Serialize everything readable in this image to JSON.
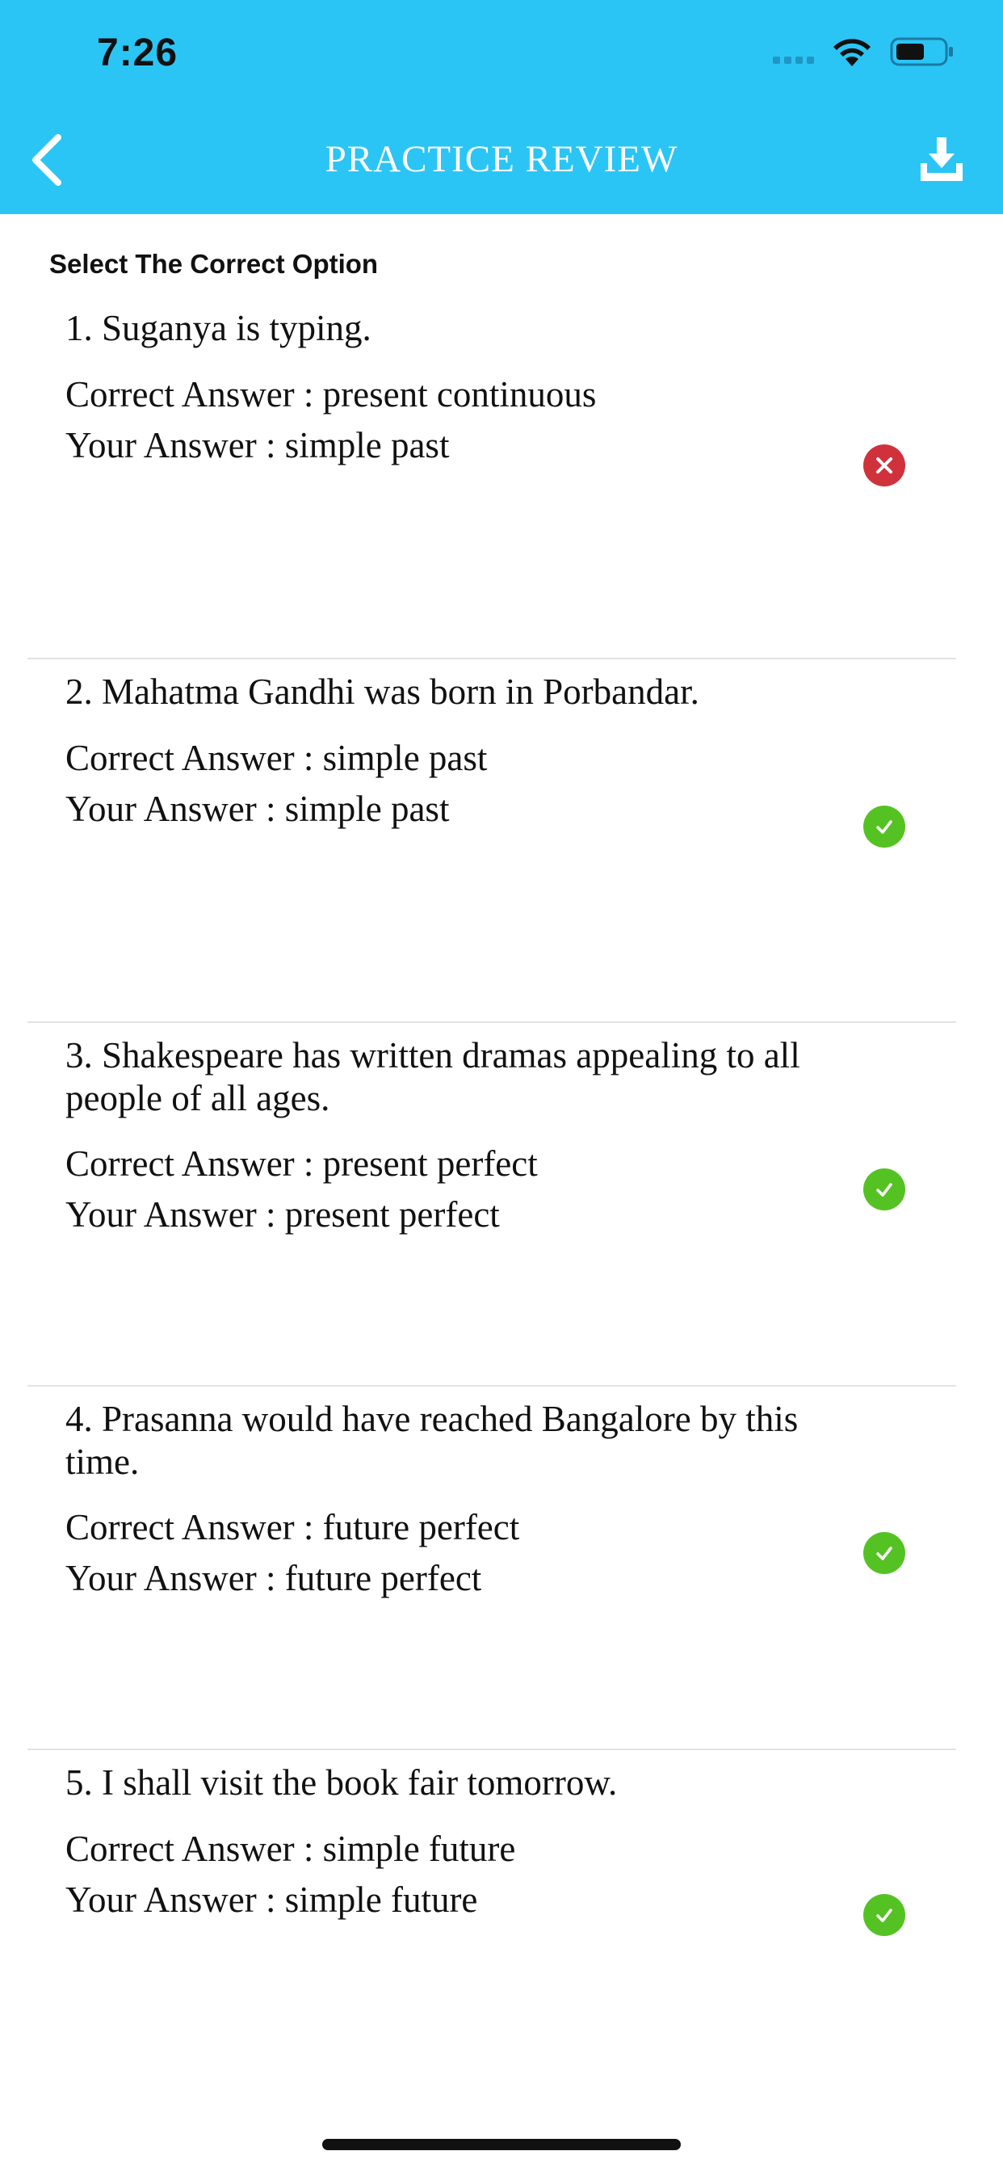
{
  "status_bar": {
    "time": "7:26"
  },
  "header": {
    "title": "PRACTICE REVIEW",
    "back_icon": "chevron-left-icon",
    "download_icon": "download-icon",
    "background_color": "#2bc5f5"
  },
  "section_title": "Select The Correct Option",
  "labels": {
    "correct_prefix": "Correct Answer : ",
    "your_prefix": "Your Answer : "
  },
  "questions": [
    {
      "text": "1. Suganya is typing.",
      "correct_line": "Correct Answer : present continuous",
      "your_line": "Your Answer : simple past",
      "is_correct": false
    },
    {
      "text": "2. Mahatma Gandhi was born in Porbandar.",
      "correct_line": "Correct Answer : simple past",
      "your_line": "Your Answer : simple past",
      "is_correct": true
    },
    {
      "text": "3. Shakespeare has written dramas appealing to all people of all ages.",
      "correct_line": "Correct Answer : present perfect",
      "your_line": "Your Answer : present perfect",
      "is_correct": true
    },
    {
      "text": "4. Prasanna would have reached Bangalore by this time.",
      "correct_line": "Correct Answer : future perfect",
      "your_line": "Your Answer : future perfect",
      "is_correct": true
    },
    {
      "text": "5. I shall visit the book fair tomorrow.",
      "correct_line": "Correct Answer : simple future",
      "your_line": "Your Answer : simple future",
      "is_correct": true
    }
  ],
  "colors": {
    "correct": "#55c223",
    "wrong": "#d0323b"
  }
}
